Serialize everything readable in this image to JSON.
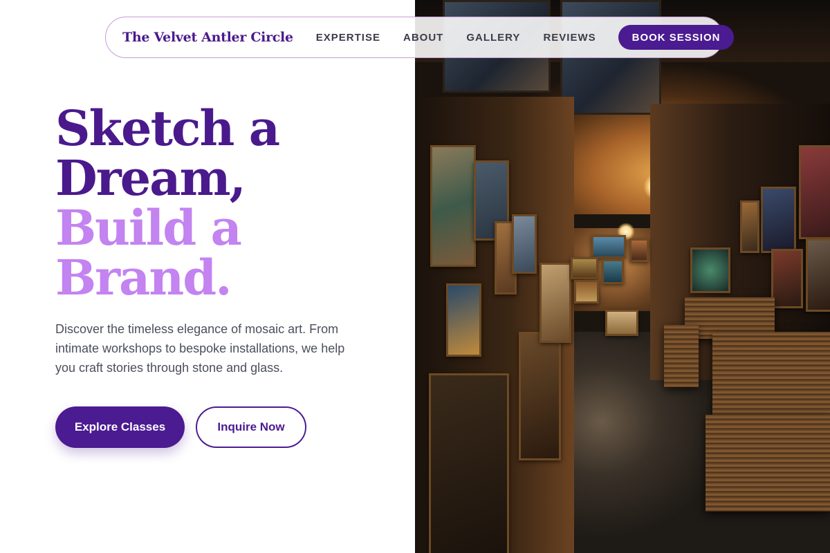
{
  "nav": {
    "brand": "The Velvet Antler Circle",
    "links": [
      "EXPERTISE",
      "ABOUT",
      "GALLERY",
      "REVIEWS"
    ],
    "cta_label": "BOOK SESSION"
  },
  "hero": {
    "headline_line1": "Sketch a",
    "headline_line2": "Dream,",
    "headline_line3": "Build a",
    "headline_line4": "Brand.",
    "description": "Discover the timeless elegance of mosaic art. From intimate workshops to bespoke installations, we help you craft stories through stone and glass.",
    "primary_button": "Explore Classes",
    "secondary_button": "Inquire Now"
  },
  "colors": {
    "primary": "#4b1b91",
    "accent": "#c383f0",
    "text_muted": "#4b4f5c",
    "nav_border": "#c99ad6"
  },
  "photo": {
    "icon": "art-gallery-photo"
  }
}
